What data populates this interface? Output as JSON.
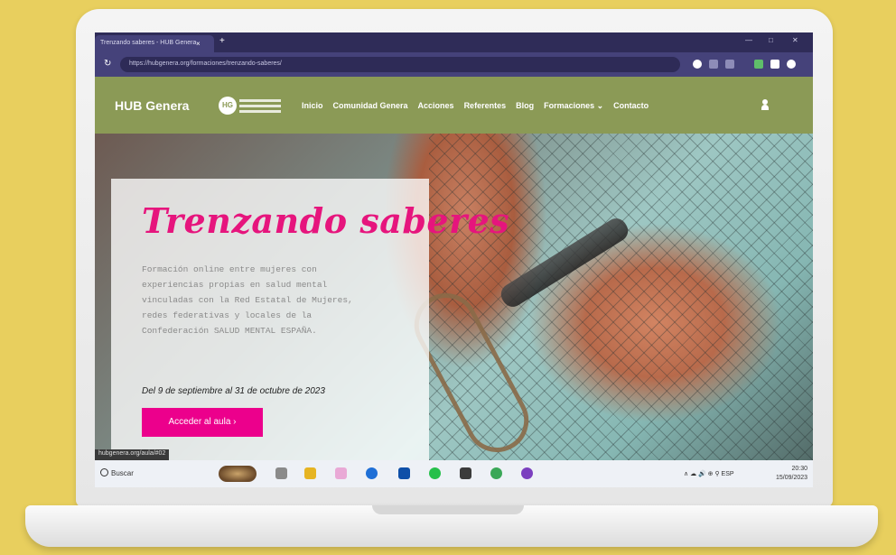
{
  "browser": {
    "tab_title": "Trenzando saberes - HUB Genera",
    "tab_close": "×",
    "new_tab": "+",
    "url": "https://hubgenera.org/formaciones/trenzando-saberes/",
    "window_controls": [
      "—",
      "□",
      "✕"
    ]
  },
  "site": {
    "brand": "HUB Genera",
    "brand_logo_text": "HG",
    "nav": [
      "Inicio",
      "Comunidad Genera",
      "Acciones",
      "Referentes",
      "Blog",
      "Formaciones ⌄",
      "Contacto"
    ]
  },
  "hero": {
    "title": "Trenzando saberes",
    "description": "Formación online entre mujeres con experiencias propias en salud mental vinculadas con la Red Estatal de Mujeres, redes federativas y locales de la Confederación SALUD MENTAL ESPAÑA.",
    "dates": "Del 9 de septiembre al 31 de octubre de 2023",
    "button": "Acceder al aula  ›"
  },
  "status_tip": "hubgenera.org/aula/#02",
  "taskbar": {
    "search": "Buscar",
    "tray": "∧  ☁  🔊  ⊕  ⚲  ESP",
    "time": "20:30",
    "date": "15/09/2023"
  },
  "colors": {
    "page_bg": "#e8cf5e",
    "nav_green": "#8b9a56",
    "accent_pink": "#ec008c",
    "browser_bar": "#2f2c58"
  }
}
